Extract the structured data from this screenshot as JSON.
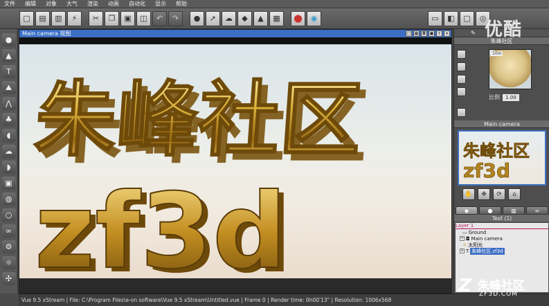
{
  "menu": [
    "文件",
    "编辑",
    "对象",
    "大气",
    "渲染",
    "动画",
    "自动化",
    "显示",
    "帮助"
  ],
  "toolbar_icons": [
    "new-icon",
    "open-icon",
    "save-icon",
    "lightning-icon",
    "cut-icon",
    "copy-icon",
    "paste-icon",
    "duplicate-icon",
    "undo-icon",
    "redo-icon",
    "bomb-icon",
    "pointer-icon",
    "cloud-icon",
    "cube-icon",
    "terrain-icon",
    "grid-icon",
    "palette-icon",
    "palette2-icon",
    "film-icon",
    "clapper-icon",
    "frame-icon",
    "globe-icon"
  ],
  "viewport": {
    "title": "Main camera 视图",
    "scene_text_line1": "朱峰社区",
    "scene_text_line2": "zf3d"
  },
  "status_bar": "Vue 9.5 xStream | File: C:\\Program Files\\e-on software\\Vue 9.5 xStream\\Untitled.vue | Frame 0 | Render time: 0h00'13\" | Resolution: 1006x568",
  "right_panel": {
    "material_title": "朱峰社区",
    "material_badge": "10m",
    "scale_label": "比例",
    "scale_value": "1.00",
    "camera_title": "Main camera",
    "camera_thumb_line1": "朱峰社区",
    "camera_thumb_line2": "zf3d",
    "objects_header": "Text (1)",
    "tree": [
      {
        "label": "Layer 1",
        "type": "layer"
      },
      {
        "label": "Ground",
        "type": "item"
      },
      {
        "label": "Main camera",
        "type": "item"
      },
      {
        "label": "太阳光",
        "type": "item"
      },
      {
        "label": "朱峰社区.zf3d",
        "type": "selected"
      }
    ]
  },
  "watermark": {
    "top": "优酷",
    "bottom_cn": "朱峰社区",
    "bottom_en": "ZF3D.COM",
    "bottom_logo": "Z"
  },
  "colors": {
    "accent": "#3c6fc4",
    "gold": "#d4a93a"
  }
}
